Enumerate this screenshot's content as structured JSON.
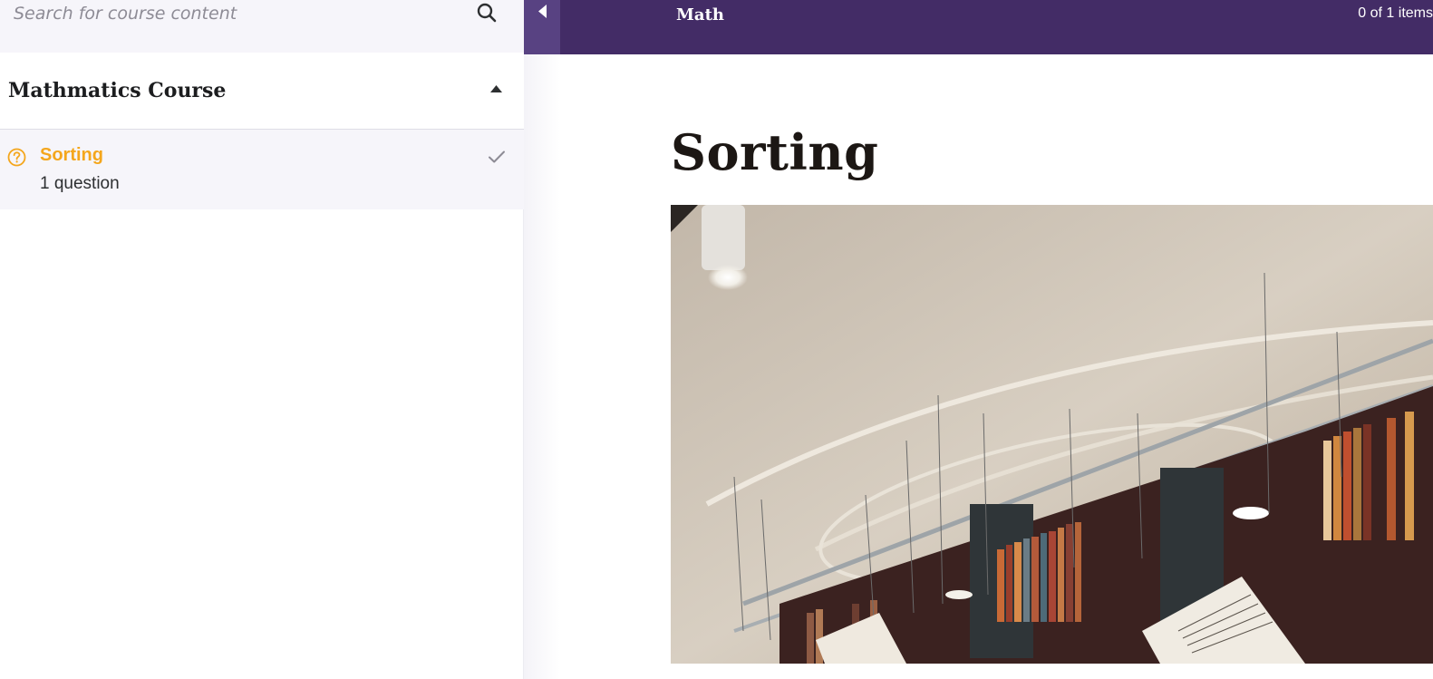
{
  "search": {
    "placeholder": "Search for course content"
  },
  "sidebar": {
    "section_title": "Mathmatics Course",
    "section_expanded": true,
    "items": [
      {
        "title": "Sorting",
        "meta": "1 question",
        "type_icon": "question-circle-icon",
        "status_icon": "check-icon",
        "active": true
      }
    ]
  },
  "topbar": {
    "course_label": "Math",
    "progress": "0 of 1 items"
  },
  "main": {
    "title": "Sorting",
    "image_alt": "library-hanging-books-photo"
  },
  "colors": {
    "topbar_bg": "#432c66",
    "collapse_bg": "#584282",
    "accent_orange": "#f4a61c",
    "sidebar_bg": "#f6f5fa"
  }
}
